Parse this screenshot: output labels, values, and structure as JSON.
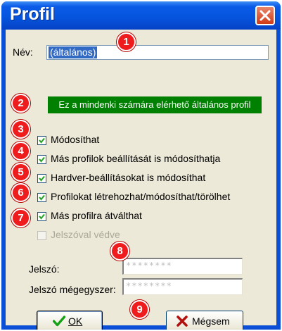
{
  "window": {
    "title": "Profil"
  },
  "name": {
    "label": "Név:",
    "value": "(általános)"
  },
  "banner": "Ez a mindenki számára elérhető általános profil",
  "checkboxes": [
    {
      "label": "Módosíthat",
      "checked": true,
      "enabled": true
    },
    {
      "label": "Más profilok beállítását is módosíthatja",
      "checked": true,
      "enabled": true
    },
    {
      "label": "Hardver-beállításokat is módosíthat",
      "checked": true,
      "enabled": true
    },
    {
      "label": "Profilokat létrehozhat/módosíthat/törölhet",
      "checked": true,
      "enabled": true
    },
    {
      "label": "Más profilra átválthat",
      "checked": true,
      "enabled": true
    },
    {
      "label": "Jelszóval védve",
      "checked": false,
      "enabled": false
    }
  ],
  "password": {
    "label": "Jelszó:",
    "value": "********"
  },
  "password_confirm": {
    "label": "Jelszó mégegyszer:",
    "value": "********"
  },
  "buttons": {
    "ok": "OK",
    "cancel": "Mégsem"
  },
  "badges": [
    "1",
    "2",
    "3",
    "4",
    "5",
    "6",
    "7",
    "8",
    "9"
  ],
  "colors": {
    "title_bar": "#0655df",
    "banner_bg": "#008000",
    "badge": "#ee1c1c",
    "close_button": "#d13b17"
  }
}
